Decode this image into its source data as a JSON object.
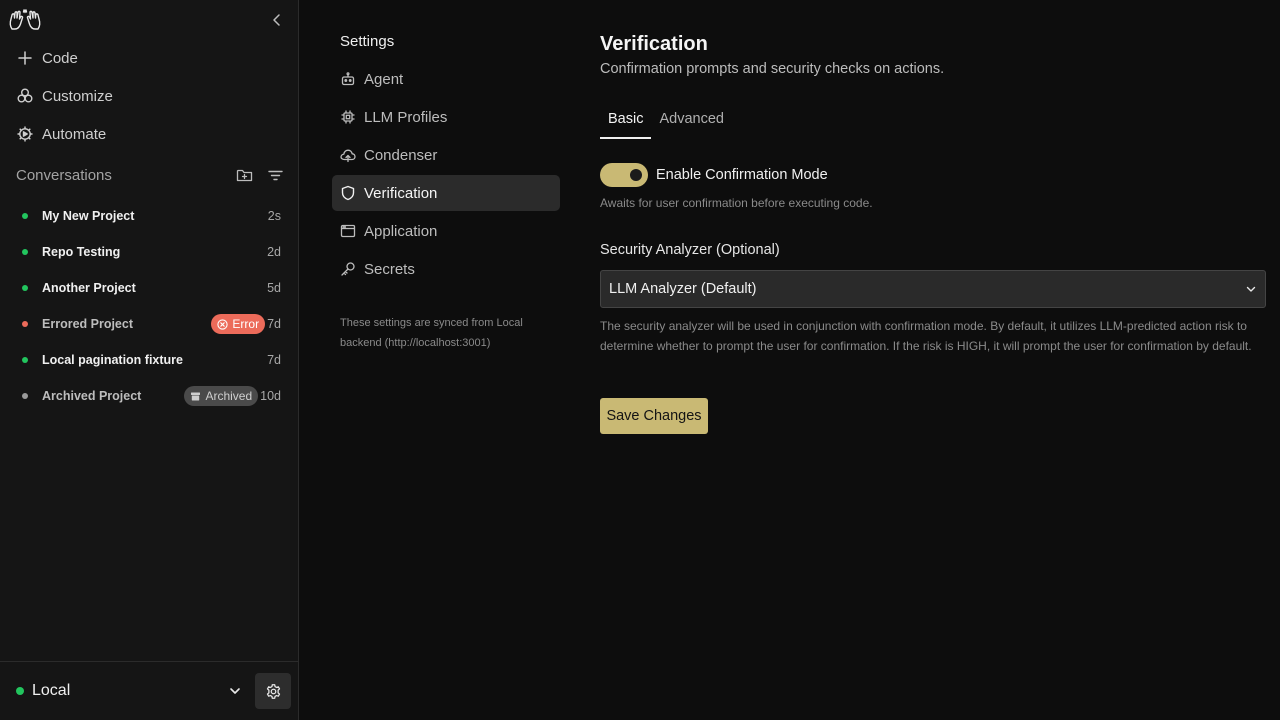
{
  "colors": {
    "accent": "#c9b974",
    "status_ok": "#22c55e",
    "status_error": "#ec6b5a",
    "status_archived": "#9a9a9a"
  },
  "sidebar": {
    "logo_icon": "waving-hands-icon",
    "collapse_icon": "chevron-left-icon",
    "nav": [
      {
        "label": "Code",
        "icon": "plus-icon"
      },
      {
        "label": "Customize",
        "icon": "customize-icon"
      },
      {
        "label": "Automate",
        "icon": "automate-icon"
      }
    ],
    "conversations": {
      "title": "Conversations",
      "actions": [
        "new-folder-icon",
        "filter-icon"
      ],
      "items": [
        {
          "name": "My New Project",
          "time": "2s",
          "status": "active"
        },
        {
          "name": "Repo Testing",
          "time": "2d",
          "status": "active"
        },
        {
          "name": "Another Project",
          "time": "5d",
          "status": "active"
        },
        {
          "name": "Errored Project",
          "time": "7d",
          "status": "error",
          "badge": "Error"
        },
        {
          "name": "Local pagination fixture",
          "time": "7d",
          "status": "active"
        },
        {
          "name": "Archived Project",
          "time": "10d",
          "status": "archived",
          "badge": "Archived"
        }
      ]
    },
    "footer": {
      "backend": "Local",
      "settings_icon": "gear-icon"
    }
  },
  "settings_nav": {
    "title": "Settings",
    "items": [
      {
        "label": "Agent",
        "icon": "robot-icon"
      },
      {
        "label": "LLM Profiles",
        "icon": "chip-icon"
      },
      {
        "label": "Condenser",
        "icon": "cloud-icon"
      },
      {
        "label": "Verification",
        "icon": "shield-icon",
        "active": true
      },
      {
        "label": "Application",
        "icon": "window-icon"
      },
      {
        "label": "Secrets",
        "icon": "key-icon"
      }
    ],
    "sync_note": "These settings are synced from Local backend (http://localhost:3001)"
  },
  "main": {
    "title": "Verification",
    "subtitle": "Confirmation prompts and security checks on actions.",
    "tabs": [
      {
        "label": "Basic",
        "active": true
      },
      {
        "label": "Advanced",
        "active": false
      }
    ],
    "confirmation": {
      "label": "Enable Confirmation Mode",
      "enabled": true,
      "hint": "Awaits for user confirmation before executing code."
    },
    "analyzer": {
      "label": "Security Analyzer (Optional)",
      "selected": "LLM Analyzer (Default)",
      "help": "The security analyzer will be used in conjunction with confirmation mode. By default, it utilizes LLM-predicted action risk to determine whether to prompt the user for confirmation. If the risk is HIGH, it will prompt the user for confirmation by default."
    },
    "save_label": "Save Changes"
  }
}
